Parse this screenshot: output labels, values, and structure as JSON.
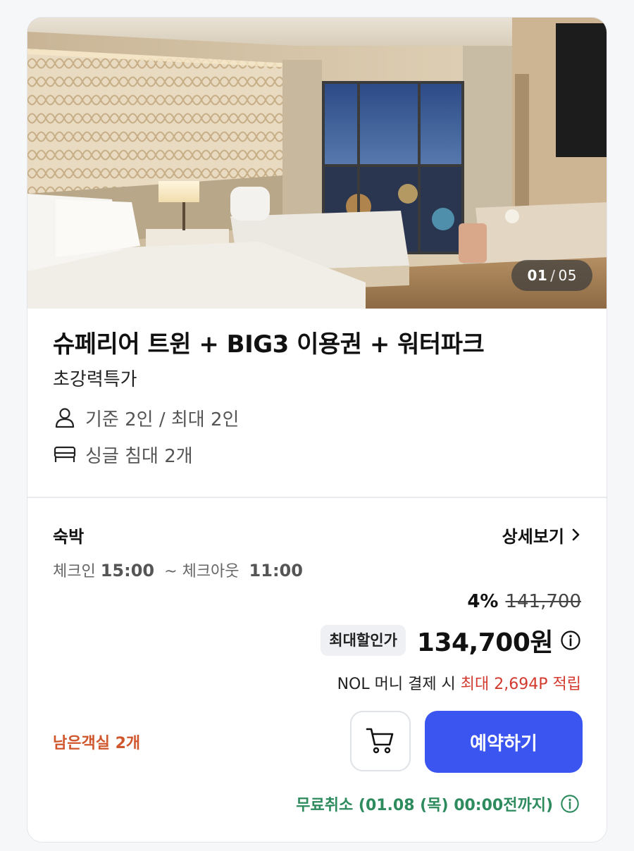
{
  "gallery": {
    "current": "01",
    "separator": "/",
    "total": "05"
  },
  "room": {
    "title": "슈페리어 트윈 + BIG3 이용권 + 워터파크",
    "subtitle": "초강력특가",
    "occupancy": "기준 2인 / 최대 2인",
    "beds": "싱글 침대 2개",
    "icons": {
      "occupancy": "person-icon",
      "beds": "bed-icon"
    }
  },
  "stay": {
    "label": "숙박",
    "detail_link": "상세보기",
    "checkin_label": "체크인",
    "checkin_time": "15:00",
    "separator": "~",
    "checkout_label": "체크아웃",
    "checkout_time": "11:00"
  },
  "price": {
    "discount": "4%",
    "original": "141,700",
    "tag": "최대할인가",
    "final": "134,700원",
    "nol_prefix": "NOL 머니 결제 시",
    "nol_point": "최대 2,694P 적립"
  },
  "actions": {
    "remaining": "남은객실 2개",
    "book_label": "예약하기",
    "cart_icon": "cart-icon",
    "free_cancel": "무료취소 (01.08 (목) 00:00전까지)"
  },
  "colors": {
    "accent": "#3a55f0",
    "point_red": "#d33a2f",
    "remaining_orange": "#d0562c",
    "cancel_green": "#2e8b5e"
  }
}
